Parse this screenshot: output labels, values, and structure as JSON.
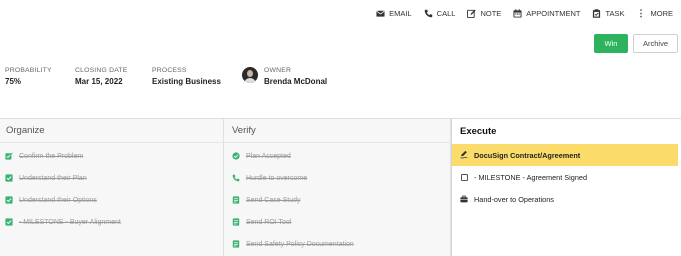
{
  "toolbar": {
    "email": "EMAIL",
    "call": "CALL",
    "note": "NOTE",
    "appointment": "APPOINTMENT",
    "task": "TASK",
    "more": "MORE"
  },
  "actions": {
    "win": "Win",
    "archive": "Archive"
  },
  "info": {
    "probability_label": "PROBABILITY",
    "probability_value": "75%",
    "closing_label": "CLOSING DATE",
    "closing_value": "Mar 15, 2022",
    "process_label": "PROCESS",
    "process_value": "Existing Business",
    "owner_label": "OWNER",
    "owner_value": "Brenda McDonal"
  },
  "colors": {
    "win": "#2db35d",
    "done_icon": "#3cb371",
    "active_task": "#fbdc6a"
  },
  "stages": {
    "organize": {
      "title": "Organize",
      "tasks": [
        {
          "label": "Confirm the Problem",
          "icon": "edit-check-icon"
        },
        {
          "label": "Understand their Plan",
          "icon": "check-square-icon"
        },
        {
          "label": "Understand their Options",
          "icon": "check-square-icon"
        },
        {
          "label": "- MILESTONE - Buyer Alignment",
          "icon": "check-square-icon"
        }
      ]
    },
    "verify": {
      "title": "Verify",
      "tasks": [
        {
          "label": "Plan Accepted",
          "icon": "check-circle-icon"
        },
        {
          "label": "Hurdle to overcome",
          "icon": "phone-icon"
        },
        {
          "label": "Send Case Study",
          "icon": "document-icon"
        },
        {
          "label": "Send ROI Tool",
          "icon": "document-icon"
        },
        {
          "label": "Send Safety Policy Documentation",
          "icon": "document-icon"
        }
      ]
    },
    "execute": {
      "title": "Execute",
      "tasks": [
        {
          "label": "DocuSign Contract/Agreement",
          "icon": "signature-icon"
        },
        {
          "label": "- MILESTONE - Agreement Signed",
          "icon": "checkbox-icon"
        },
        {
          "label": "Hand-over to Operations",
          "icon": "briefcase-icon"
        }
      ]
    }
  }
}
